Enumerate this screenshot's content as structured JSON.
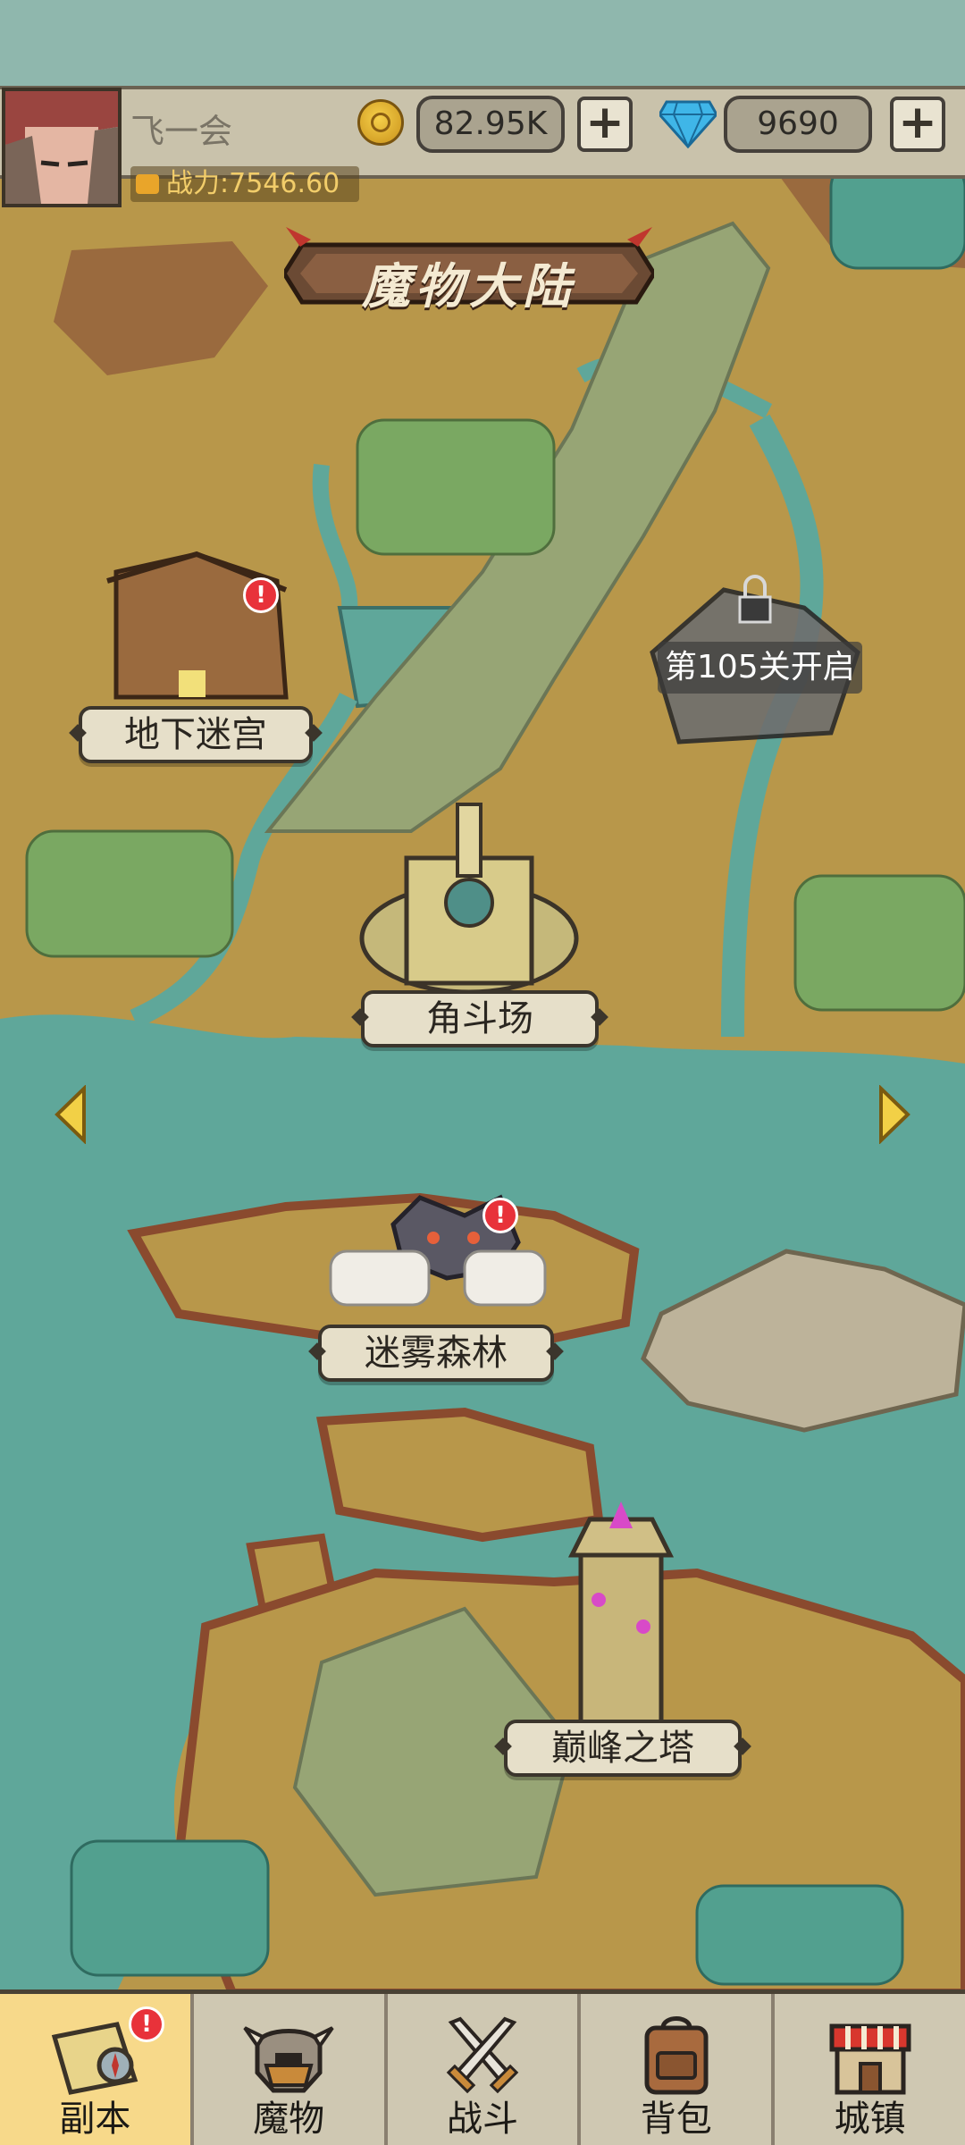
{
  "header": {
    "player_name": "飞一会",
    "power_label": "战力:7546.60",
    "gold": "82.95K",
    "gems": "9690",
    "plus_label": "+"
  },
  "map": {
    "title": "魔物大陆",
    "locations": [
      {
        "label": "地下迷宫",
        "alert": true
      },
      {
        "label": "角斗场",
        "alert": false
      },
      {
        "label": "迷雾森林",
        "alert": true
      },
      {
        "label": "巅峰之塔",
        "alert": false
      }
    ],
    "locked_location": {
      "label": "第105关开启"
    }
  },
  "badges": {
    "alert_mark": "!"
  },
  "nav": {
    "items": [
      {
        "label": "副本",
        "icon": "map-scroll-icon",
        "active": true,
        "alert": true
      },
      {
        "label": "魔物",
        "icon": "monster-helmet-icon",
        "active": false
      },
      {
        "label": "战斗",
        "icon": "crossed-swords-icon",
        "active": false
      },
      {
        "label": "背包",
        "icon": "backpack-icon",
        "active": false
      },
      {
        "label": "城镇",
        "icon": "shop-icon",
        "active": false
      }
    ]
  },
  "colors": {
    "water": "#5fa79a",
    "land": "#b8974a",
    "forest": "#7aa862",
    "nav_active": "#f7d98a",
    "alert": "#e8323a"
  }
}
